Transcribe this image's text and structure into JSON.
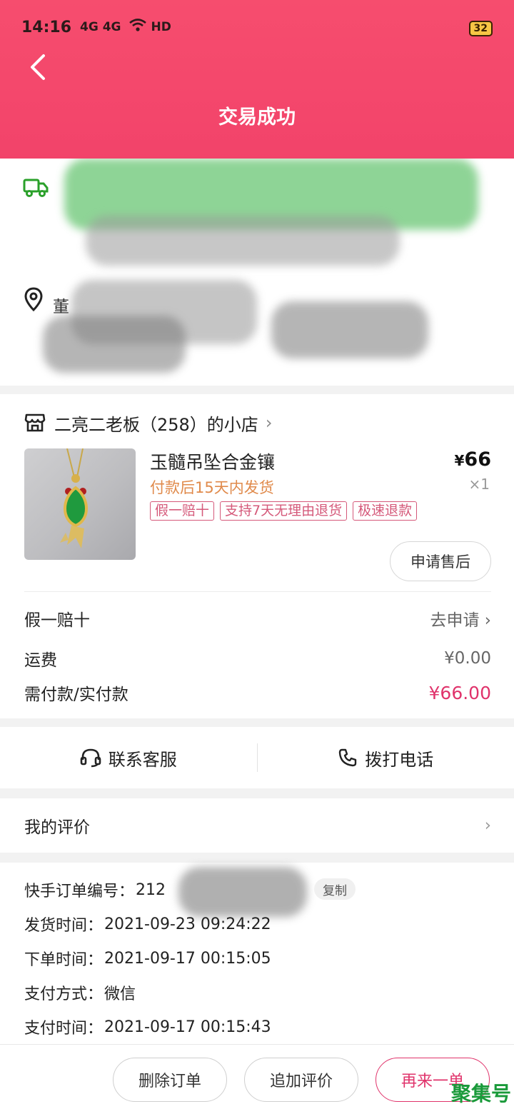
{
  "status_bar": {
    "time": "14:16",
    "network": "4G 4G",
    "wifi": "HD",
    "battery": "32"
  },
  "header": {
    "title": "交易成功"
  },
  "address": {
    "name_partial": "董"
  },
  "shop": {
    "name": "二亮二老板（258）的小店"
  },
  "product": {
    "title": "玉髓吊坠合金镶",
    "price_symbol": "¥",
    "price": "66",
    "quantity": "×1",
    "ship_note": "付款后15天内发货",
    "tags": [
      "假一赔十",
      "支持7天无理由退货",
      "极速退款"
    ],
    "after_sale_label": "申请售后"
  },
  "fees": {
    "guarantee_label": "假一赔十",
    "guarantee_action": "去申请",
    "shipping_label": "运费",
    "shipping_value": "¥0.00",
    "total_label": "需付款/实付款",
    "total_value": "¥66.00"
  },
  "contact": {
    "service_label": "联系客服",
    "phone_label": "拨打电话"
  },
  "review": {
    "label": "我的评价"
  },
  "order_info": {
    "order_no_label": "快手订单编号：",
    "order_no_value": "212",
    "copy_label": "复制",
    "ship_time_label": "发货时间：",
    "ship_time_value": "2021-09-23 09:24:22",
    "order_time_label": "下单时间：",
    "order_time_value": "2021-09-17 00:15:05",
    "pay_method_label": "支付方式：",
    "pay_method_value": "微信",
    "pay_time_label": "支付时间：",
    "pay_time_value": "2021-09-17 00:15:43"
  },
  "actions": {
    "delete_label": "删除订单",
    "append_review_label": "追加评价",
    "reorder_label": "再来一单"
  },
  "watermark": {
    "text": "聚集号"
  },
  "colors": {
    "header": "#f2436a",
    "accent": "#e0336b",
    "ship_note": "#e08a4b",
    "truck_icon": "#2aa02a"
  }
}
